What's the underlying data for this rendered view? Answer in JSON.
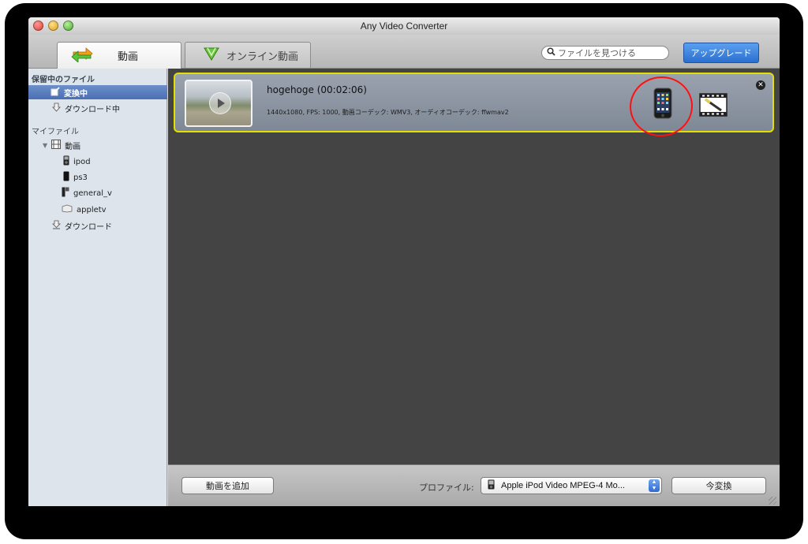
{
  "window": {
    "title": "Any Video Converter"
  },
  "toolbar": {
    "tabs": [
      {
        "label": "動画",
        "icon": "convert-arrows-icon",
        "active": true
      },
      {
        "label": "オンライン動画",
        "icon": "download-arrow-icon",
        "active": false
      }
    ],
    "search_placeholder": "ファイルを見つける",
    "upgrade_label": "アップグレード"
  },
  "sidebar": {
    "section1_heading": "保留中のファイル",
    "section1_items": [
      {
        "label": "変換中",
        "icon": "convert-icon",
        "selected": true
      },
      {
        "label": "ダウンロード中",
        "icon": "download-icon",
        "selected": false
      }
    ],
    "section2_heading": "マイファイル",
    "video_folder": {
      "label": "動画",
      "icon": "film-icon"
    },
    "video_children": [
      {
        "label": "ipod",
        "icon": "ipod-icon"
      },
      {
        "label": "ps3",
        "icon": "ps3-icon"
      },
      {
        "label": "general_v",
        "icon": "general-video-icon"
      },
      {
        "label": "appletv",
        "icon": "appletv-icon"
      }
    ],
    "download_item": {
      "label": "ダウンロード",
      "icon": "download-icon"
    }
  },
  "queue": {
    "item": {
      "title": "hogehoge  (00:02:06)",
      "info": "1440x1080, FPS: 1000, 動画コーデック: WMV3, オーディオコーデック: ffwmav2",
      "device_icon": "iphone-icon",
      "edit_icon": "video-edit-icon"
    }
  },
  "bottom": {
    "add_video_label": "動画を追加",
    "profile_label": "プロファイル:",
    "profile_value": "Apple iPod Video MPEG-4 Mo...",
    "convert_label": "今変換"
  },
  "colors": {
    "selection_blue": "#4a6fb3",
    "highlight_yellow": "#e2e000",
    "annotation_red": "#ff1010",
    "main_bg": "#444444"
  }
}
